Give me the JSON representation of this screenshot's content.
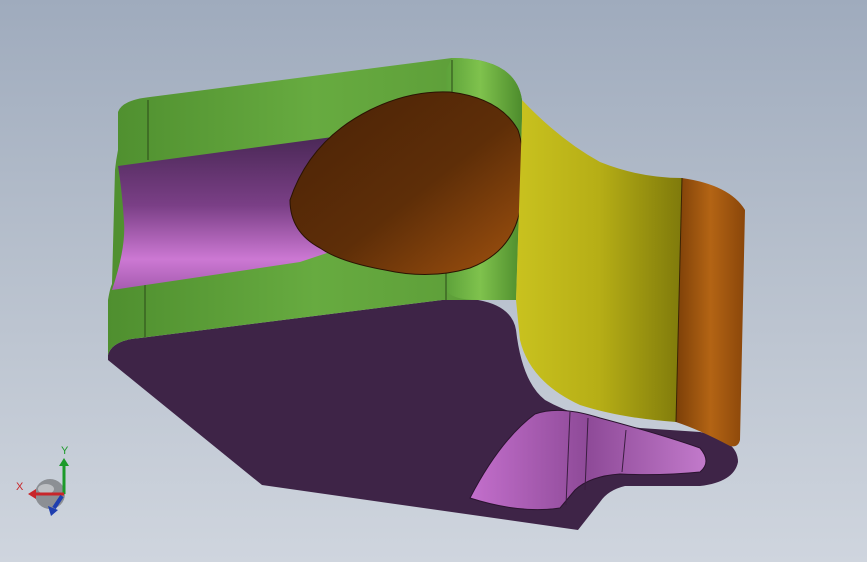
{
  "viewport": {
    "background_top": "#9fabbd",
    "background_bottom": "#cfd5de"
  },
  "model": {
    "part_type": "3D solid part (CAD model view)",
    "face_colors": {
      "green_side": "#5c9e3a",
      "purple_bottom": "#3e2447",
      "purple_bore": "#b86cc0",
      "brown_hole": "#5a2c08",
      "yellow_curve": "#b9b316",
      "orange_edge": "#a9560f"
    }
  },
  "triad": {
    "x_label": "X",
    "y_label": "Y",
    "x_color": "#c8262a",
    "y_color": "#1c9a2a",
    "z_color": "#1f3fb0"
  }
}
